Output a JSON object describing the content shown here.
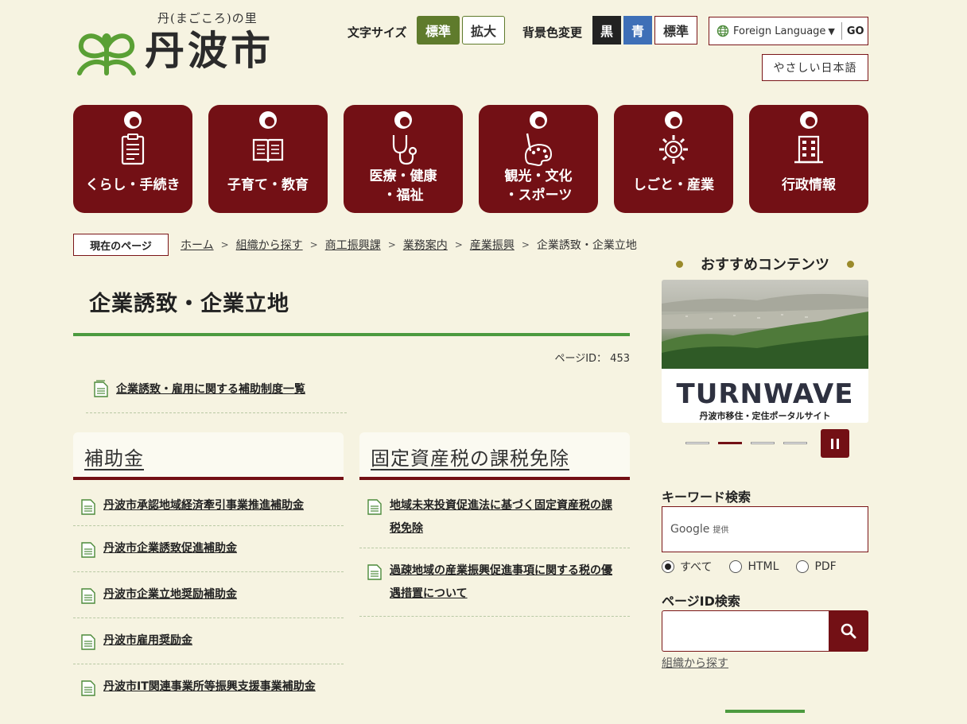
{
  "header": {
    "tagline": "丹(まごころ)の里",
    "site_name": "丹波市",
    "font_size_label": "文字サイズ",
    "font_size_standard": "標準",
    "font_size_large": "拡大",
    "bg_color_label": "背景色変更",
    "bg_black": "黒",
    "bg_blue": "青",
    "bg_standard": "標準",
    "language_select": "Foreign Language",
    "language_go": "GO",
    "easy_japanese": "やさしい日本語"
  },
  "global_nav": [
    {
      "label": "くらし・手続き",
      "icon": "clipboard-icon"
    },
    {
      "label": "子育て・教育",
      "icon": "book-icon"
    },
    {
      "label": "医療・健康\n・福祉",
      "icon": "stethoscope-icon"
    },
    {
      "label": "観光・文化\n・スポーツ",
      "icon": "palette-icon"
    },
    {
      "label": "しごと・産業",
      "icon": "gear-icon"
    },
    {
      "label": "行政情報",
      "icon": "building-icon"
    }
  ],
  "breadcrumb": {
    "here_label": "現在のページ",
    "items": [
      "ホーム",
      "組織から探す",
      "商工振興課",
      "業務案内",
      "産業振興"
    ],
    "current": "企業誘致・企業立地"
  },
  "main": {
    "title": "企業誘致・企業立地",
    "page_id": "ページID： 453",
    "lead_link": "企業誘致・雇用に関する補助制度一覧",
    "sections": [
      {
        "heading": "補助金",
        "links": [
          "丹波市承認地域経済牽引事業推進補助金",
          "丹波市企業誘致促進補助金",
          "丹波市企業立地奨励補助金",
          "丹波市雇用奨励金",
          "丹波市IT関連事業所等振興支援事業補助金"
        ]
      },
      {
        "heading": "固定資産税の課税免除",
        "links": [
          "地域未来投資促進法に基づく固定資産税の課税免除",
          "過疎地域の産業振興促進事項に関する税の優遇措置について"
        ]
      }
    ]
  },
  "sidebar": {
    "recommend_title": "おすすめコンテンツ",
    "banner": {
      "logo_text": "TURNWAVE",
      "subtitle": "丹波市移住・定住ポータルサイト"
    },
    "slider_active_index": 1,
    "keyword_search_label": "キーワード検索",
    "google_label": "Google",
    "google_provided": "提供",
    "search_scope_options": [
      "すべて",
      "HTML",
      "PDF"
    ],
    "search_scope_selected": "すべて",
    "page_id_search_label": "ページID検索",
    "org_search_link": "組織から探す"
  },
  "colors": {
    "background": "#f6f3e1",
    "brand_maroon": "#731015",
    "accent_green": "#4c9a3f",
    "font_size_active": "#5f7b2c",
    "bg_blue_button": "#3e6fb7"
  }
}
